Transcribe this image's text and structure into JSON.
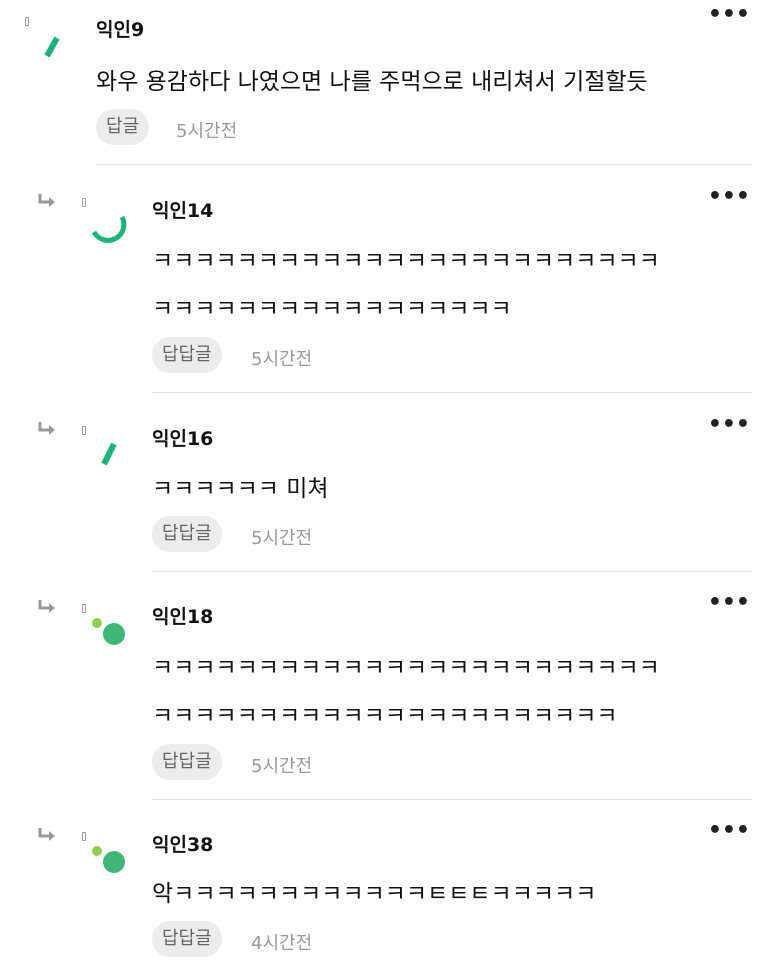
{
  "comments": [
    {
      "username": "익인9",
      "lines": [
        "와우 용감하다 나였으면 나를 주먹으로 내리쳐서 기절할듯"
      ],
      "reply_label": "답글",
      "time": "5시간전",
      "avatar": "green-slash-icon"
    },
    {
      "username": "익인14",
      "lines": [
        "ㅋㅋㅋㅋㅋㅋㅋㅋㅋㅋㅋㅋㅋㅋㅋㅋㅋㅋㅋㅋㅋㅋㅋㅋ",
        "ㅋㅋㅋㅋㅋㅋㅋㅋㅋㅋㅋㅋㅋㅋㅋㅋㅋ"
      ],
      "reply_label": "답답글",
      "time": "5시간전",
      "avatar": "green-arc-icon"
    },
    {
      "username": "익인16",
      "lines": [
        "ㅋㅋㅋㅋㅋㅋ 미쳐"
      ],
      "reply_label": "답답글",
      "time": "5시간전",
      "avatar": "green-slash-icon"
    },
    {
      "username": "익인18",
      "lines": [
        "ㅋㅋㅋㅋㅋㅋㅋㅋㅋㅋㅋㅋㅋㅋㅋㅋㅋㅋㅋㅋㅋㅋㅋㅋ",
        "ㅋㅋㅋㅋㅋㅋㅋㅋㅋㅋㅋㅋㅋㅋㅋㅋㅋㅋㅋㅋㅋㅋ"
      ],
      "reply_label": "답답글",
      "time": "5시간전",
      "avatar": "green-dots-icon"
    },
    {
      "username": "익인38",
      "lines": [
        "악ㅋㅋㅋㅋㅋㅋㅋㅋㅋㅋㅋㅋㅌㅌㅌㅋㅋㅋㅋㅋ"
      ],
      "reply_label": "답답글",
      "time": "4시간전",
      "avatar": "green-dots-icon"
    }
  ],
  "more_label": "•••",
  "colors": {
    "accent_green": "#1db47a",
    "lime": "#8fd14f",
    "dot_green": "#3fb877"
  }
}
